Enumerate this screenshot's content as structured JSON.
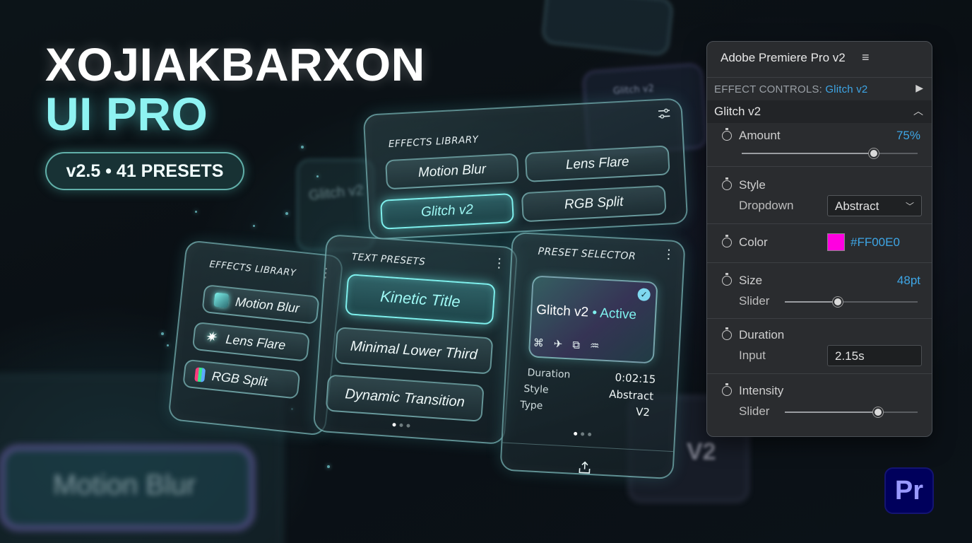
{
  "hero": {
    "title_line1": "XOJIAKBARXON",
    "title_line2": "UI PRO",
    "badge": "v2.5 • 41 PRESETS"
  },
  "background": {
    "glitch_text": "Glitch v2",
    "motion_blur_text": "Motion Blur",
    "v2_text": "V2"
  },
  "effects_library_top": {
    "heading": "EFFECTS LIBRARY",
    "items": [
      {
        "label": "Motion Blur",
        "active": false
      },
      {
        "label": "Lens Flare",
        "active": false
      },
      {
        "label": "Glitch v2",
        "active": true
      },
      {
        "label": "RGB Split",
        "active": false
      }
    ]
  },
  "effects_library_small": {
    "heading": "EFFECTS LIBRARY",
    "items": [
      {
        "label": "Motion Blur",
        "icon": "motion-blur-icon"
      },
      {
        "label": "Lens Flare",
        "icon": "lens-flare-icon"
      },
      {
        "label": "RGB Split",
        "icon": "rgb-split-icon"
      }
    ]
  },
  "text_presets": {
    "heading": "TEXT PRESETS",
    "items": [
      {
        "label": "Kinetic Title",
        "active": true
      },
      {
        "label": "Minimal Lower Third",
        "active": false
      },
      {
        "label": "Dynamic Transition",
        "active": false
      }
    ]
  },
  "preset_selector": {
    "heading": "PRESET SELECTOR",
    "preset_name": "Glitch v2",
    "preset_state": "• Active",
    "tile_icons": [
      "⌘",
      "✈",
      "⧉",
      "♒"
    ],
    "meta": [
      {
        "label": "Duration",
        "value": "0:02:15"
      },
      {
        "label": "Style",
        "value": "Abstract"
      },
      {
        "label": "Type",
        "value": "V2"
      }
    ]
  },
  "panel": {
    "title": "Adobe Premiere Pro  v2",
    "menu_icon": "≡",
    "effect_controls_label": "EFFECT CONTROLS: ",
    "effect_controls_target": "Glitch v2",
    "section_title": "Glitch v2",
    "amount": {
      "label": "Amount",
      "value": "75%",
      "level": 0.75
    },
    "style": {
      "label": "Style",
      "sub": "Dropdown",
      "value": "Abstract"
    },
    "color": {
      "label": "Color",
      "value": "#FF00E0",
      "swatch": "#FF00E0"
    },
    "size": {
      "label": "Size",
      "sub": "Slider",
      "value": "48pt",
      "level": 0.4
    },
    "duration": {
      "label": "Duration",
      "sub": "Input",
      "value": "2.15s"
    },
    "intensity": {
      "label": "Intensity",
      "sub": "Slider",
      "level": 0.7
    }
  },
  "logo": {
    "text": "Pr"
  },
  "colors": {
    "accent": "#7FF1EE",
    "link": "#3EA6E6",
    "logo_bg": "#00005C",
    "logo_fg": "#9999FF"
  }
}
